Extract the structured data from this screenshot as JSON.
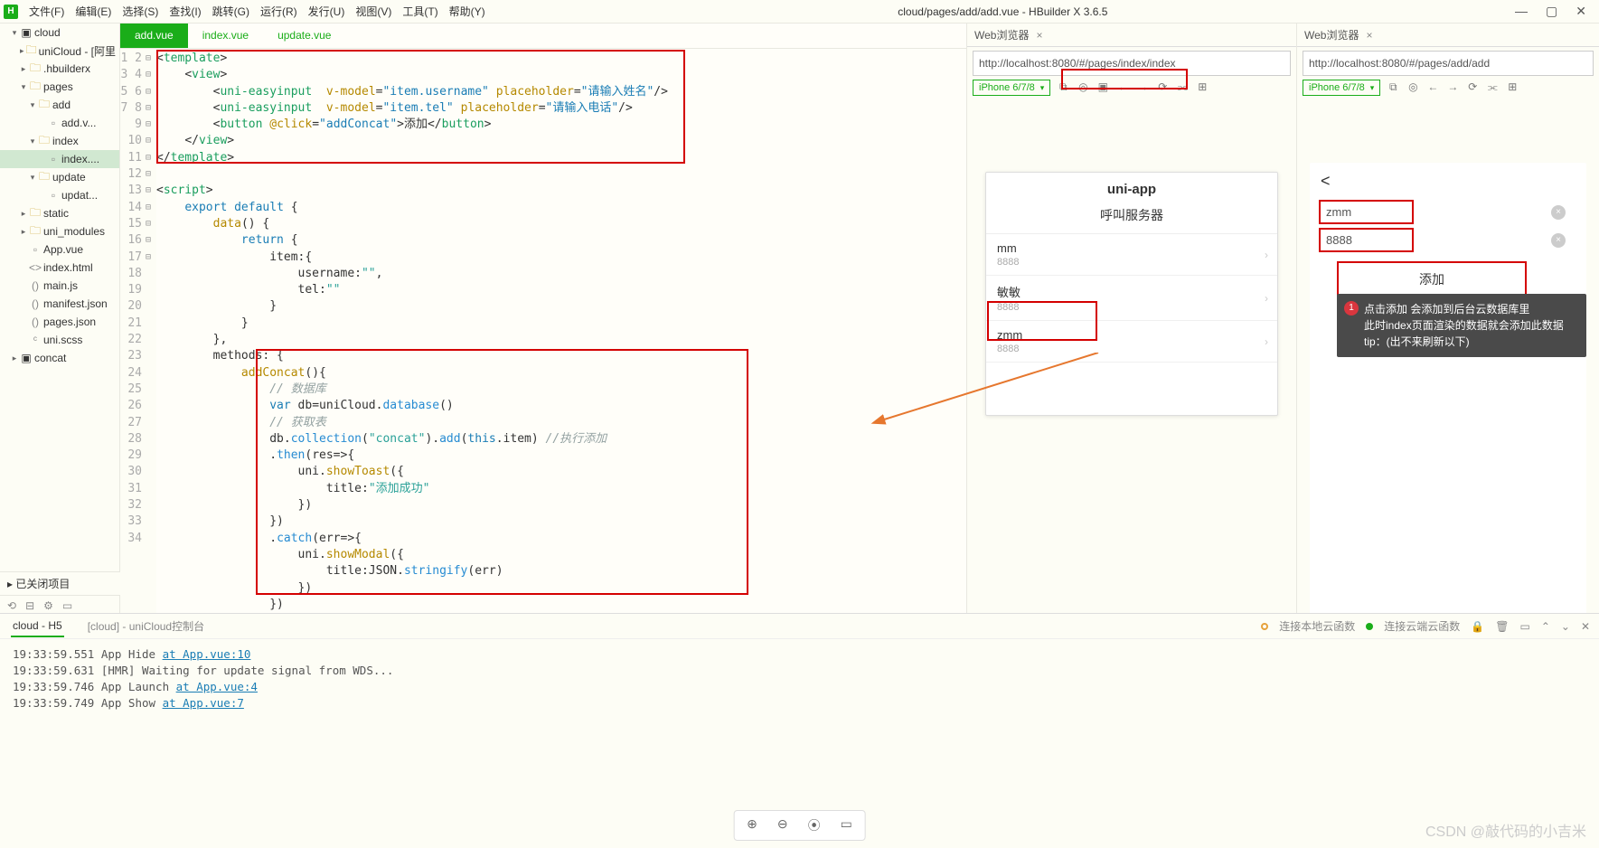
{
  "title_center": "cloud/pages/add/add.vue - HBuilder X 3.6.5",
  "menu": [
    "文件(F)",
    "编辑(E)",
    "选择(S)",
    "查找(I)",
    "跳转(G)",
    "运行(R)",
    "发行(U)",
    "视图(V)",
    "工具(T)",
    "帮助(Y)"
  ],
  "sidebar": {
    "root": "cloud",
    "nodes": [
      {
        "indent": 1,
        "chev": "▾",
        "icon": "▣",
        "label": "cloud",
        "cls": ""
      },
      {
        "indent": 2,
        "chev": "▸",
        "icon": "🗀",
        "label": "uniCloud - [阿里",
        "cls": "folder-ico"
      },
      {
        "indent": 2,
        "chev": "▸",
        "icon": "🗀",
        "label": ".hbuilderx",
        "cls": "folder-ico"
      },
      {
        "indent": 2,
        "chev": "▾",
        "icon": "🗀",
        "label": "pages",
        "cls": "folder-ico"
      },
      {
        "indent": 3,
        "chev": "▾",
        "icon": "🗀",
        "label": "add",
        "cls": "folder-ico"
      },
      {
        "indent": 4,
        "chev": "",
        "icon": "▫",
        "label": "add.v...",
        "cls": "file-ico"
      },
      {
        "indent": 3,
        "chev": "▾",
        "icon": "🗀",
        "label": "index",
        "cls": "folder-ico"
      },
      {
        "indent": 4,
        "chev": "",
        "icon": "▫",
        "label": "index....",
        "cls": "file-ico",
        "sel": true
      },
      {
        "indent": 3,
        "chev": "▾",
        "icon": "🗀",
        "label": "update",
        "cls": "folder-ico"
      },
      {
        "indent": 4,
        "chev": "",
        "icon": "▫",
        "label": "updat...",
        "cls": "file-ico"
      },
      {
        "indent": 2,
        "chev": "▸",
        "icon": "🗀",
        "label": "static",
        "cls": "folder-ico"
      },
      {
        "indent": 2,
        "chev": "▸",
        "icon": "🗀",
        "label": "uni_modules",
        "cls": "folder-ico"
      },
      {
        "indent": 2,
        "chev": "",
        "icon": "▫",
        "label": "App.vue",
        "cls": "file-ico"
      },
      {
        "indent": 2,
        "chev": "",
        "icon": "<>",
        "label": "index.html",
        "cls": "file-ico"
      },
      {
        "indent": 2,
        "chev": "",
        "icon": "()",
        "label": "main.js",
        "cls": "file-ico"
      },
      {
        "indent": 2,
        "chev": "",
        "icon": "()",
        "label": "manifest.json",
        "cls": "file-ico"
      },
      {
        "indent": 2,
        "chev": "",
        "icon": "()",
        "label": "pages.json",
        "cls": "file-ico"
      },
      {
        "indent": 2,
        "chev": "",
        "icon": "ᶜ",
        "label": "uni.scss",
        "cls": "file-ico"
      },
      {
        "indent": 1,
        "chev": "▸",
        "icon": "▣",
        "label": "concat",
        "cls": ""
      }
    ],
    "closed": "已关闭项目"
  },
  "tabs": [
    "add.vue",
    "index.vue",
    "update.vue"
  ],
  "code_lines": [
    "<span class='p'>&lt;</span><span class='t'>template</span><span class='p'>&gt;</span>",
    "    <span class='p'>&lt;</span><span class='t'>view</span><span class='p'>&gt;</span>",
    "        <span class='p'>&lt;</span><span class='t'>uni-easyinput</span>  <span class='a'>v-model</span>=<span class='sc'>\"item.username\"</span> <span class='a'>placeholder</span>=<span class='sc'>\"请输入姓名\"</span><span class='p'>/&gt;</span>",
    "        <span class='p'>&lt;</span><span class='t'>uni-easyinput</span>  <span class='a'>v-model</span>=<span class='sc'>\"item.tel\"</span> <span class='a'>placeholder</span>=<span class='sc'>\"请输入电话\"</span><span class='p'>/&gt;</span>",
    "        <span class='p'>&lt;</span><span class='t'>button</span> <span class='a'>@click</span>=<span class='sc'>\"addConcat\"</span><span class='p'>&gt;</span>添加<span class='p'>&lt;/</span><span class='t'>button</span><span class='p'>&gt;</span>",
    "    <span class='p'>&lt;/</span><span class='t'>view</span><span class='p'>&gt;</span>",
    "<span class='p'>&lt;/</span><span class='t'>template</span><span class='p'>&gt;</span>",
    "",
    "<span class='p'>&lt;</span><span class='t'>script</span><span class='p'>&gt;</span>",
    "    <span class='k'>export</span> <span class='k'>default</span> {",
    "        <span class='f'>data</span>() {",
    "            <span class='k'>return</span> {",
    "                item:{",
    "                    username:<span class='s'>\"\"</span>,",
    "                    tel:<span class='s'>\"\"</span>",
    "                }",
    "            }",
    "        },",
    "        methods: {",
    "            <span class='f'>addConcat</span>(){",
    "                <span class='c'>// 数据库</span>",
    "                <span class='k'>var</span> db=uniCloud.<span class='m'>database</span>()",
    "                <span class='c'>// 获取表</span>",
    "                db.<span class='m'>collection</span>(<span class='s'>\"concat\"</span>).<span class='m'>add</span>(<span class='k'>this</span>.item) <span class='c'>//执行添加</span>",
    "                .<span class='m'>then</span>(res=&gt;{",
    "                    uni.<span class='f'>showToast</span>({",
    "                        title:<span class='s'>\"添加成功\"</span>",
    "                    })",
    "                })",
    "                .<span class='m'>catch</span>(err=&gt;{",
    "                    uni.<span class='f'>showModal</span>({",
    "                        title:JSON.<span class='m'>stringify</span>(err)",
    "                    })",
    "                })"
  ],
  "browser1": {
    "tab": "Web浏览器",
    "url": "http://localhost:8080/#/pages/index/index",
    "device": "iPhone 6/7/8",
    "app_title": "uni-app",
    "sub": "呼叫服务器",
    "items": [
      {
        "n": "mm",
        "v": "8888"
      },
      {
        "n": "敏敏",
        "v": "8888"
      },
      {
        "n": "zmm",
        "v": "8888"
      }
    ]
  },
  "browser2": {
    "tab": "Web浏览器",
    "url": "http://localhost:8080/#/pages/add/add",
    "device": "iPhone 6/7/8",
    "input1": "zmm",
    "input2": "8888",
    "btn": "添加",
    "tip_lines": [
      "点击添加 会添加到后台云数据库里",
      "此时index页面渲染的数据就会添加此数据",
      "tip：(出不来刷新以下)"
    ]
  },
  "console": {
    "tabs": [
      "cloud - H5",
      "[cloud] - uniCloud控制台"
    ],
    "status1": "连接本地云函数",
    "status2": "连接云端云函数",
    "log": [
      {
        "t": "19:33:59.551 App Hide ",
        "l": "at App.vue:10"
      },
      {
        "t": "19:33:59.631 [HMR] Waiting for update signal from WDS...",
        "l": ""
      },
      {
        "t": "19:33:59.746 App Launch ",
        "l": "at App.vue:4"
      },
      {
        "t": "19:33:59.749 App Show ",
        "l": "at App.vue:7"
      }
    ]
  },
  "watermark": "CSDN @敲代码的小吉米"
}
